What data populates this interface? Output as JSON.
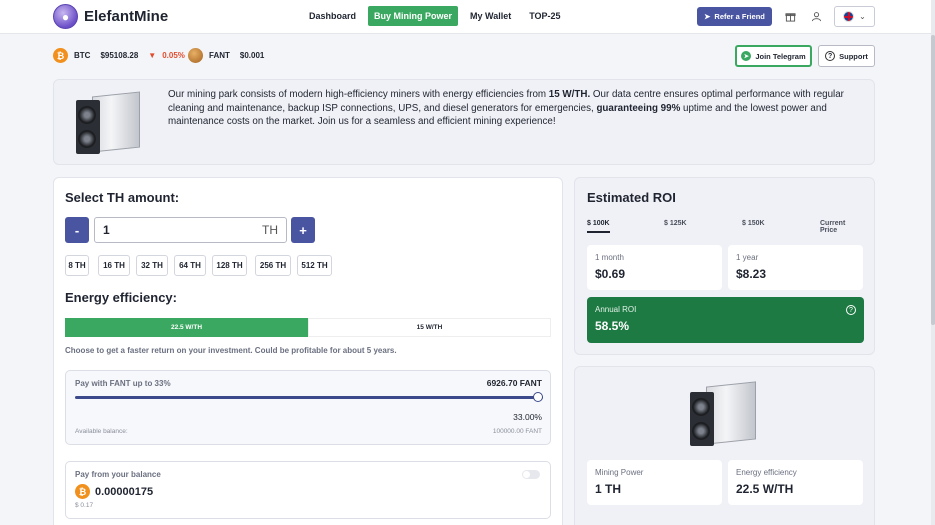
{
  "brand": {
    "name": "ElefantMine"
  },
  "nav": {
    "links": [
      "Dashboard",
      "Buy Mining Power",
      "My Wallet",
      "TOP-25"
    ],
    "active": "Buy Mining Power",
    "refer_label": "Refer a Friend"
  },
  "ticker": {
    "btc": {
      "symbol": "BTC",
      "price": "$95108.28",
      "change": "0.05%"
    },
    "fant": {
      "symbol": "FANT",
      "price": "$0.001"
    },
    "telegram_label": "Join Telegram",
    "support_label": "Support"
  },
  "info": {
    "part1": "Our mining park consists of modern high-efficiency miners with energy efficiencies from ",
    "bold1": "15 W/TH.",
    "part2": " Our data centre ensures optimal performance with regular cleaning and maintenance, backup ISP connections, UPS, and diesel generators for emergencies, ",
    "bold2": "guaranteeing 99%",
    "part3": " uptime and the lowest power and maintenance costs on the market. Join us for a seamless and efficient mining experience!"
  },
  "select_th": {
    "title": "Select TH amount:",
    "minus": "-",
    "plus": "+",
    "value": "1",
    "unit": "TH",
    "presets": [
      "8 TH",
      "16 TH",
      "32 TH",
      "64 TH",
      "128 TH",
      "256 TH",
      "512 TH"
    ]
  },
  "energy": {
    "title": "Energy efficiency:",
    "options": [
      "22.5 W/TH",
      "15 W/TH"
    ],
    "selected": "22.5 W/TH",
    "hint": "Choose to get a faster return on your investment. Could be profitable for about 5 years."
  },
  "pay_fant": {
    "label": "Pay with FANT up to 33%",
    "amount": "6926.70 FANT",
    "percent": "33.00%",
    "slider_fraction": 1.0,
    "available_label": "Available balance:",
    "available_value": "100000.00 FANT"
  },
  "pay_balance": {
    "label": "Pay from your balance",
    "btc_amount": "0.00000175",
    "usd_amount": "$ 0.17"
  },
  "roi": {
    "title": "Estimated ROI",
    "tabs": [
      "$ 100K",
      "$ 125K",
      "$ 150K",
      "Current Price"
    ],
    "active_tab": "$ 100K",
    "month_label": "1 month",
    "month_value": "$0.69",
    "year_label": "1 year",
    "year_value": "$8.23",
    "annual_label": "Annual ROI",
    "annual_value": "58.5%"
  },
  "specs": {
    "power_label": "Mining Power",
    "power_value": "1 TH",
    "eff_label": "Energy efficiency",
    "eff_value": "22.5 W/TH"
  },
  "colors": {
    "accent": "#4a55a2",
    "green": "#3aa860",
    "dark_green": "#1e7a43",
    "btc_orange": "#f2901e",
    "down_red": "#e24c2e"
  }
}
